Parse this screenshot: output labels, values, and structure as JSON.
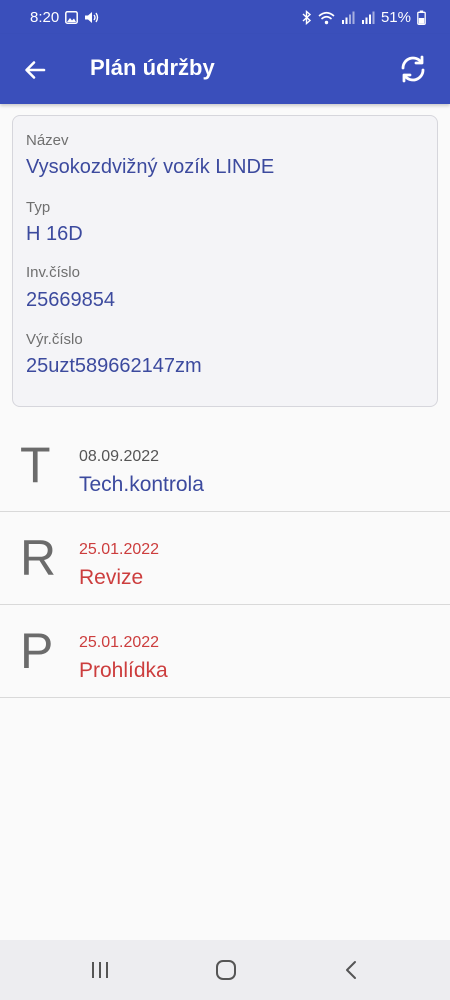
{
  "status_bar": {
    "time": "8:20",
    "battery": "51%",
    "icons": [
      "image-icon",
      "volume-icon",
      "bluetooth-icon",
      "wifi-icon",
      "signal-icon",
      "signal-icon",
      "battery-icon"
    ]
  },
  "app_bar": {
    "title": "Plán údržby",
    "back_icon": "arrow-left-icon",
    "refresh_icon": "refresh-icon",
    "background": "#3a4fbb"
  },
  "info_card": {
    "fields": [
      {
        "label": "Název",
        "value": "Vysokozdvižný vozík LINDE"
      },
      {
        "label": "Typ",
        "value": "H 16D"
      },
      {
        "label": "Inv.číslo",
        "value": "25669854"
      },
      {
        "label": "Výr.číslo",
        "value": "25uzt589662147zm"
      }
    ]
  },
  "maintenance_items": [
    {
      "letter": "T",
      "date": "08.09.2022",
      "name": "Tech.kontrola",
      "date_color": "#555555",
      "name_color": "#3c4a9e"
    },
    {
      "letter": "R",
      "date": "25.01.2022",
      "name": "Revize",
      "date_color": "#cc3d3d",
      "name_color": "#cc3d3d"
    },
    {
      "letter": "P",
      "date": "25.01.2022",
      "name": "Prohlídka",
      "date_color": "#cc3d3d",
      "name_color": "#cc3d3d"
    }
  ],
  "nav_bar": {
    "icons": [
      "recent-apps-icon",
      "home-icon",
      "back-icon"
    ]
  }
}
